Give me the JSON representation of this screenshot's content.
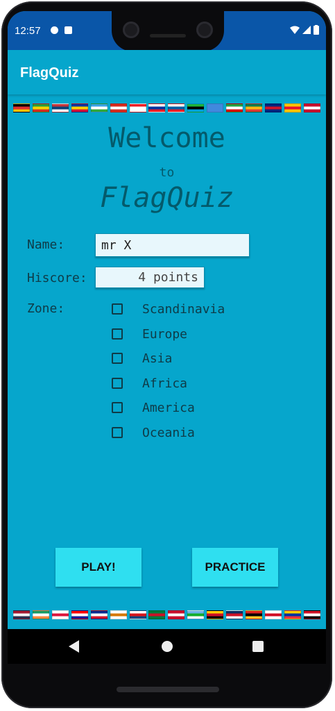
{
  "status_bar": {
    "time": "12:57"
  },
  "app": {
    "title": "FlagQuiz"
  },
  "welcome": {
    "line1": "Welcome",
    "line2": "to",
    "line3": "FlagQuiz"
  },
  "form": {
    "name_label": "Name:",
    "name_value": "mr X",
    "hiscore_label": "Hiscore:",
    "hiscore_value": "4 points",
    "zone_label": "Zone:",
    "zones": [
      "Scandinavia",
      "Europe",
      "Asia",
      "Africa",
      "America",
      "Oceania"
    ]
  },
  "buttons": {
    "play": "PLAY!",
    "practice": "PRACTICE"
  },
  "colors": {
    "status_bar": "#0a56a8",
    "background": "#06a6cc",
    "button": "#2fdff0"
  },
  "top_flags": [
    [
      "#000",
      "#e23030",
      "#f2c200"
    ],
    [
      "#2b9a3b",
      "#f4d400",
      "#d52b1e"
    ],
    [
      "#c6363c",
      "#0c4076",
      "#fff"
    ],
    [
      "#0033a0",
      "#ffd100",
      "#d21034"
    ],
    [
      "#3aa3e3",
      "#fff",
      "#30a838"
    ],
    [
      "#d52b1e",
      "#fff",
      "#d52b1e"
    ],
    [
      "#ee1c25",
      "#fff",
      "#fff"
    ],
    [
      "#fff",
      "#0033a0",
      "#ee1c25"
    ],
    [
      "#fff",
      "#005da4",
      "#ed1c24"
    ],
    [
      "#1eb53a",
      "#000",
      "#00a3dd"
    ],
    [
      "#4189dd",
      "#4189dd",
      "#4189dd"
    ],
    [
      "#239f40",
      "#fff",
      "#da0000"
    ],
    [
      "#007a4d",
      "#ffb612",
      "#de3831"
    ],
    [
      "#00247d",
      "#cf142b",
      "#00247d"
    ],
    [
      "#ffc400",
      "#e8112d",
      "#ffc400"
    ],
    [
      "#c8102e",
      "#fff",
      "#c8102e"
    ]
  ],
  "bottom_flags": [
    [
      "#a51931",
      "#f4f5f8",
      "#2d2a4a"
    ],
    [
      "#169b62",
      "#fff",
      "#ff883e"
    ],
    [
      "#fff",
      "#dc143c",
      "#fff"
    ],
    [
      "#ff0000",
      "#fff",
      "#171796"
    ],
    [
      "#002a8f",
      "#fff",
      "#cf142b"
    ],
    [
      "#fff",
      "#d57800",
      "#fff"
    ],
    [
      "#fff",
      "#d7141a",
      "#11457e"
    ],
    [
      "#007a3d",
      "#ce1126",
      "#007a3d"
    ],
    [
      "#c8102e",
      "#fff",
      "#c8102e"
    ],
    [
      "#6ab2e7",
      "#12ad2b",
      "#fff"
    ],
    [
      "#ffcd00",
      "#cd1126",
      "#000"
    ],
    [
      "#002d62",
      "#ce1126",
      "#fff"
    ],
    [
      "#dc241f",
      "#000",
      "#ffc726"
    ],
    [
      "#fff",
      "#cf0921",
      "#fff"
    ],
    [
      "#ffd100",
      "#0033a0",
      "#ef3340"
    ],
    [
      "#ce1126",
      "#fff",
      "#000"
    ]
  ]
}
